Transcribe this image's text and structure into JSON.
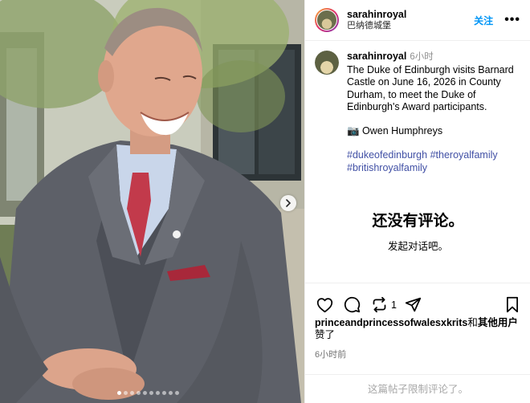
{
  "header": {
    "username": "sarahinroyal",
    "location": "巴纳德城堡",
    "follow_label": "关注",
    "more_label": "•••"
  },
  "caption": {
    "username": "sarahinroyal",
    "time": "6小时",
    "text": "The Duke of Edinburgh visits Barnard Castle on June 16, 2026 in County Durham, to meet the Duke of Edinburgh's Award participants.",
    "credit": "📷 Owen Humphreys",
    "hashtags": [
      "#dukeofedinburgh",
      "#theroyalfamily",
      "#britishroyalfamily"
    ]
  },
  "comments_empty": {
    "title": "还没有评论。",
    "subtitle": "发起对话吧。"
  },
  "actions": {
    "icons": [
      "heart-icon",
      "comment-icon",
      "repost-icon",
      "share-icon",
      "bookmark-icon"
    ],
    "repost_count": "1"
  },
  "likes": {
    "user": "princeandprincessofwalesxkrits",
    "joiner": "和",
    "others": "其他用户",
    "suffix": "赞了"
  },
  "post_time": "6小时前",
  "comments_limited": "这篇帖子限制评论了。",
  "carousel": {
    "slide_count": 10,
    "active_index": 0
  }
}
